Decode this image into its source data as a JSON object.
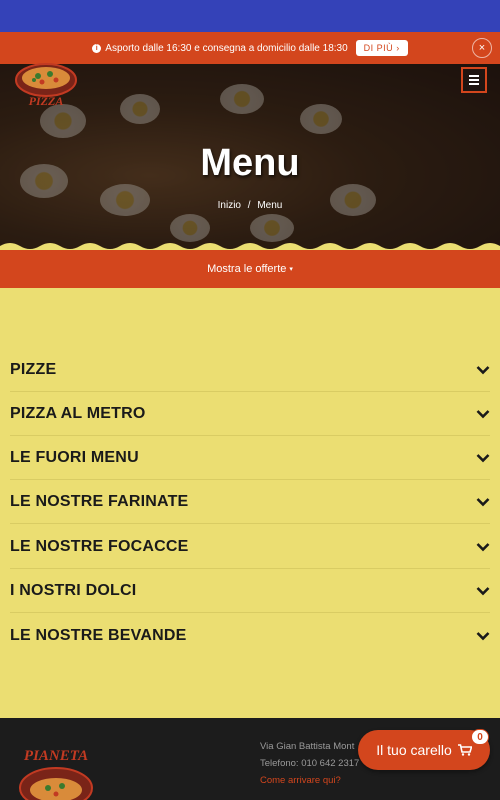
{
  "notice": {
    "text": "Asporto dalle 16:30 e consegna a domicilio dalle 18:30",
    "more_label": "DI PIÙ",
    "more_arrow": "›",
    "close_label": "×"
  },
  "brand": {
    "logo_text": "PIZZA",
    "footer_logo_text": "PIANETA"
  },
  "hero": {
    "title": "Menu",
    "breadcrumb": [
      "Inizio",
      "/",
      "Menu"
    ]
  },
  "offers": {
    "label": "Mostra le offerte",
    "caret": "▾"
  },
  "categories": [
    {
      "label": "PIZZE"
    },
    {
      "label": "PIZZA AL METRO"
    },
    {
      "label": "LE FUORI MENU"
    },
    {
      "label": "LE NOSTRE FARINATE"
    },
    {
      "label": "LE NOSTRE FOCACCE"
    },
    {
      "label": "I NOSTRI DOLCI"
    },
    {
      "label": "LE NOSTRE BEVANDE"
    }
  ],
  "footer": {
    "address": "Via Gian Battista Mont",
    "phone": "Telefono: 010 642 2317",
    "directions": "Come arrivare qui?"
  },
  "cart": {
    "label": "Il tuo carello",
    "count": "0"
  },
  "colors": {
    "accent": "#d3461d",
    "menu_bg": "#ebde72",
    "top_bar": "#3442b8",
    "footer_bg": "#1c1c1c"
  }
}
